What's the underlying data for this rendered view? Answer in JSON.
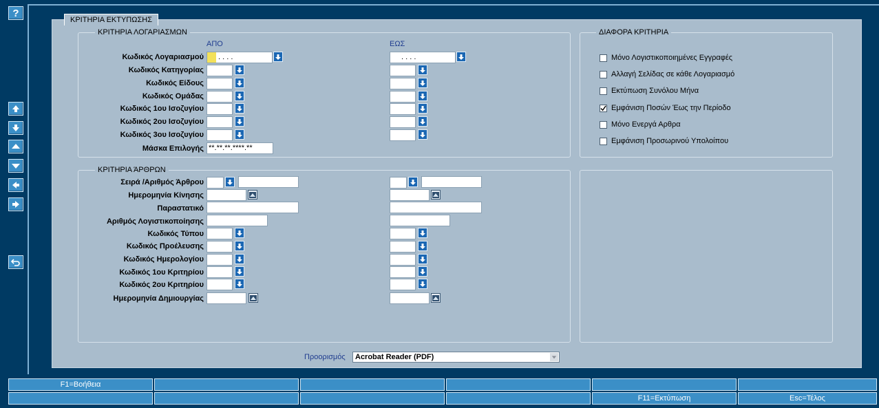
{
  "window": {
    "tab_title": "ΚΡΙΤΗΡΙΑ ΕΚΤΥΠΩΣΗΣ"
  },
  "toolbar": {
    "help_label": "?"
  },
  "accounts": {
    "title": "ΚΡΙΤΗΡΙΑ ΛΟΓΑΡΙΑΣΜΩΝ",
    "from_label": "ΑΠΟ",
    "to_label": "ΕΩΣ",
    "account_mask_value": ".   .   .   .",
    "rows": [
      {
        "label": "Κωδικός Λογαριασμού"
      },
      {
        "label": "Κωδικός Κατηγορίας"
      },
      {
        "label": "Κωδικός Είδους"
      },
      {
        "label": "Κωδικός Ομάδας"
      },
      {
        "label": "Κωδικός 1ου Ισοζυγίου"
      },
      {
        "label": "Κωδικός 2ου Ισοζυγίου"
      },
      {
        "label": "Κωδικός 3ου Ισοζυγίου"
      }
    ],
    "selection_mask_label": "Μάσκα Επιλογής",
    "selection_mask_value": "**.**.**.****.**"
  },
  "misc": {
    "title": "ΔΙΑΦΟΡΑ ΚΡΙΤΗΡΙΑ",
    "options": [
      {
        "label": "Μόνο Λογιστικοποιημένες Εγγραφές",
        "checked": false
      },
      {
        "label": "Αλλαγή Σελίδας σε κάθε Λογαριασμό",
        "checked": false
      },
      {
        "label": "Εκτύπωση Συνόλου Μήνα",
        "checked": false
      },
      {
        "label": "Εμφάνιση Ποσών Έως την Περίοδο",
        "checked": true
      },
      {
        "label": "Μόνο Ενεργά Αρθρα",
        "checked": false
      },
      {
        "label": "Εμφάνιση Προσωρινού Υπολοίπου",
        "checked": false
      }
    ]
  },
  "articles": {
    "title": "ΚΡΙΤΗΡΙΑ ΆΡΘΡΩΝ",
    "rows": [
      {
        "label": "Σειρά /Αριθμός Άρθρου"
      },
      {
        "label": "Ημερομηνία Κίνησης"
      },
      {
        "label": "Παραστατικό"
      },
      {
        "label": "Αριθμός Λογιστικοποίησης"
      },
      {
        "label": "Κωδικός Τύπου"
      },
      {
        "label": "Κωδικός Προέλευσης"
      },
      {
        "label": "Κωδικός Ημερολογίου"
      },
      {
        "label": "Κωδικός 1ου Κριτηρίου"
      },
      {
        "label": "Κωδικός 2ου Κριτηρίου"
      },
      {
        "label": "Ημερομηνία Δημιουργίας"
      }
    ]
  },
  "destination": {
    "label": "Προορισμός",
    "selected": "Acrobat Reader (PDF)"
  },
  "function_keys": {
    "row1": [
      "F1=Βοήθεια",
      "",
      "",
      "",
      "",
      ""
    ],
    "row2": [
      "",
      "",
      "",
      "",
      "F11=Εκτύπωση",
      "Esc=Τέλος"
    ]
  },
  "colors": {
    "background": "#003a63",
    "panel": "#a9bccc",
    "button": "#3b8fc7",
    "lov": "#1b67b3"
  }
}
